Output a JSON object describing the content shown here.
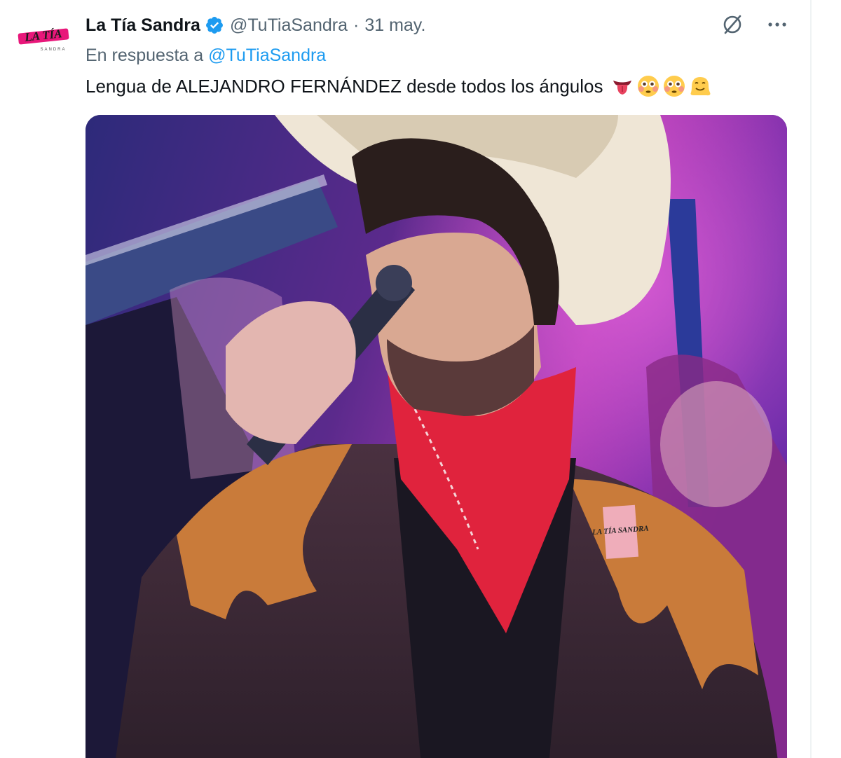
{
  "tweet": {
    "author": {
      "display_name": "La Tía Sandra",
      "handle": "@TuTiaSandra",
      "avatar_text": "LA TÍA",
      "avatar_subtext": "SANDRA"
    },
    "separator": "·",
    "timestamp": "31 may.",
    "reply_prefix": "En respuesta a",
    "reply_to": "@TuTiaSandra",
    "text": "Lengua de ALEJANDRO FERNÁNDEZ desde todos los ángulos",
    "emojis": [
      "tongue-emoji",
      "flushed-face-emoji",
      "flushed-face-emoji",
      "melting-face-emoji"
    ],
    "media": {
      "kind": "video-still",
      "description_icon": "singer-in-cowboy-hat-image",
      "watermark_text": "LA TÍA SANDRA"
    },
    "actions": {
      "grok_icon": "grok-icon",
      "more_icon": "more-icon"
    }
  },
  "colors": {
    "accent": "#1d9bf0",
    "text_primary": "#0f1419",
    "text_secondary": "#536471",
    "avatar_pink": "#e8177a"
  }
}
